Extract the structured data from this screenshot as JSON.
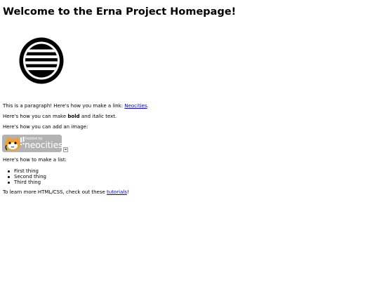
{
  "heading": "Welcome to the Erna Project Homepage!",
  "paragraph_link": {
    "before": "This is a paragraph! Here's how you make a link: ",
    "link_text": "Neocities",
    "after": "."
  },
  "formatting": {
    "before": "Here's how you can make ",
    "bold": "bold",
    "middle": " and ",
    "italic": "italic",
    "after": " text."
  },
  "image_intro": "Here's how you can add an image:",
  "badge": {
    "hosted_by": "hosted by",
    "brand": "neocities"
  },
  "list_intro": "Here's how to make a list:",
  "list_items": [
    "First thing",
    "Second thing",
    "Third thing"
  ],
  "learn_more": {
    "before": "To learn more HTML/CSS, check out these ",
    "link_text": "tutorials",
    "after": "!"
  },
  "colors": {
    "link": "#0000ee",
    "badge_background": "#b3b3b3",
    "badge_text": "#ffffff",
    "cat_orange": "#f0a030"
  },
  "icons": {
    "logo": "striped-circle-logo-icon",
    "badge_mascot": "neocities-cat-icon",
    "broken_image": "broken-image-icon"
  }
}
